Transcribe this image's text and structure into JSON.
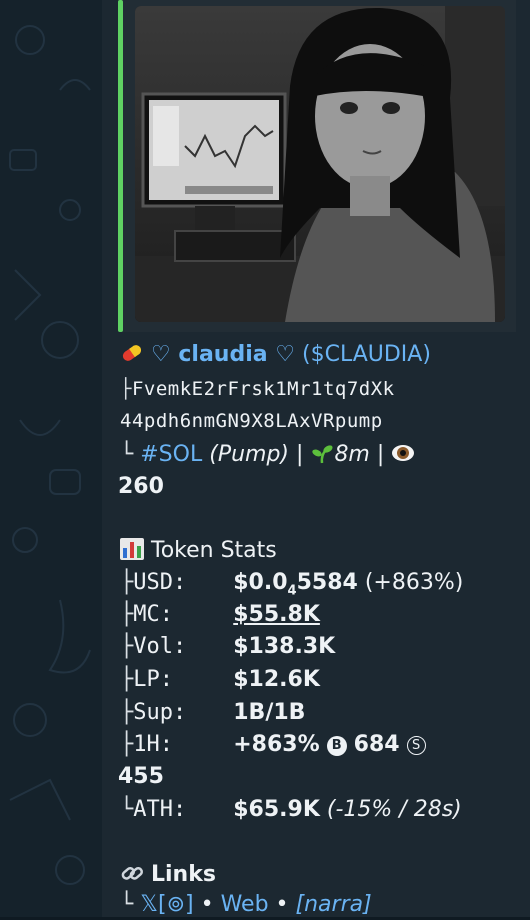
{
  "media": {
    "alt_icon": "image-thumbnail"
  },
  "token": {
    "pill_icon": "pill-icon",
    "name": "♡ claudia ♡",
    "ticker": "($CLAUDIA)",
    "address_line1": "FvemkE2rFrsk1Mr1tq7dXk",
    "address_line2": "44pdh6nmGN9X8LAxVRpump",
    "chain": "#SOL",
    "platform": "(Pump)",
    "age": "8m",
    "views": "260",
    "separator": "|"
  },
  "stats": {
    "title": "Token Stats",
    "usd_label": "USD:",
    "usd_value_prefix": "$0.0",
    "usd_value_sub": "4",
    "usd_value_rest": "5584",
    "usd_change": "(+863%)",
    "mc_label": "MC:",
    "mc_value": "$55.8K",
    "vol_label": "Vol:",
    "vol_value": "$138.3K",
    "lp_label": "LP:",
    "lp_value": "$12.6K",
    "sup_label": "Sup:",
    "sup_value": "1B/1B",
    "h1_label": "1H:",
    "h1_change": "+863%",
    "h1_buys_badge": "B",
    "h1_buys": "684",
    "h1_sells_badge": "S",
    "h1_sells": "455",
    "ath_label": "ATH:",
    "ath_value": "$65.9K",
    "ath_detail": "(-15% / 28s)"
  },
  "links": {
    "title": "Links",
    "x_label": "𝕏",
    "x_bracket": "[⊚]",
    "dot": "•",
    "web_label": "Web",
    "narrative_label": "[narra]"
  },
  "colors": {
    "bubble": "#1c2831",
    "link": "#6ab3f3",
    "accent_bar": "#5fd163"
  }
}
